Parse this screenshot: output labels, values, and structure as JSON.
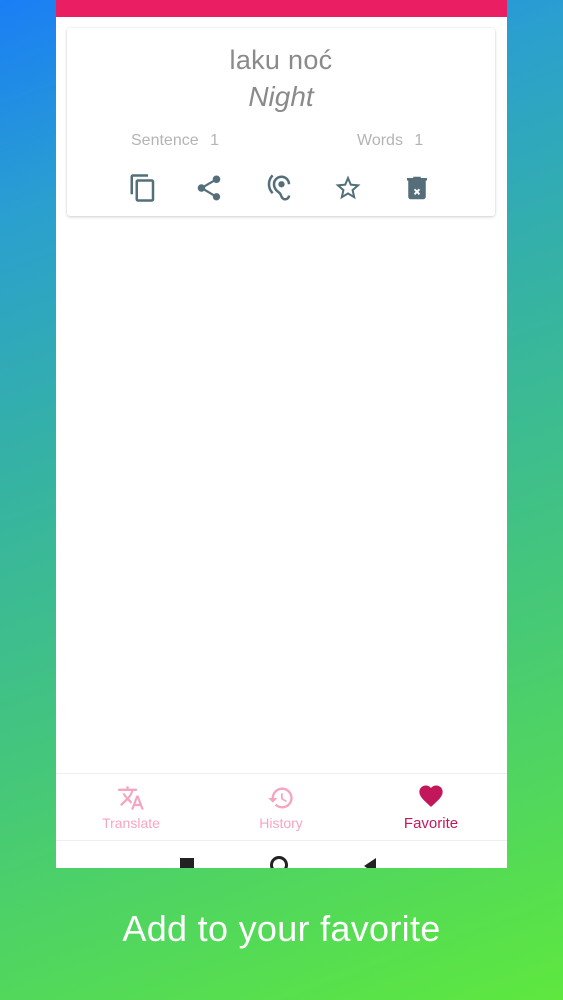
{
  "card": {
    "source_text": "laku noć",
    "translated_text": "Night",
    "sentence_label": "Sentence",
    "sentence_count": "1",
    "words_label": "Words",
    "words_count": "1",
    "actions": [
      {
        "icon": "copy-icon"
      },
      {
        "icon": "share-icon"
      },
      {
        "icon": "hearing-icon"
      },
      {
        "icon": "star-outline-icon"
      },
      {
        "icon": "delete-icon"
      }
    ]
  },
  "bottom_nav": {
    "items": [
      {
        "label": "Translate",
        "icon": "translate-icon",
        "active": false
      },
      {
        "label": "History",
        "icon": "history-icon",
        "active": false
      },
      {
        "label": "Favorite",
        "icon": "heart-icon",
        "active": true
      }
    ]
  },
  "caption": "Add to your favorite",
  "colors": {
    "accent": "#e91e63",
    "active_nav": "#c2185b",
    "inactive_nav": "#f6a5c0",
    "icon": "#546e7a"
  }
}
